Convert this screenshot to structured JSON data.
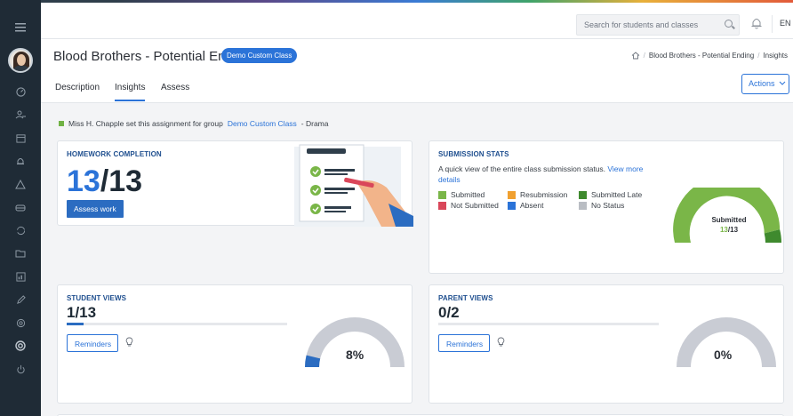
{
  "topbar": {
    "search_placeholder": "Search for students and classes",
    "language": "EN"
  },
  "header": {
    "title": "Blood Brothers - Potential Ending",
    "class_badge": "Demo Custom Class",
    "breadcrumb": [
      "Blood Brothers - Potential Ending",
      "Insights"
    ]
  },
  "tabs": [
    {
      "label": "Description"
    },
    {
      "label": "Insights",
      "active": true
    },
    {
      "label": "Assess"
    }
  ],
  "actions_label": "Actions",
  "note": {
    "prefix": "Miss H. Chapple set this assignment for group",
    "group": "Demo Custom Class",
    "suffix": "- Drama"
  },
  "homework": {
    "title": "HOMEWORK COMPLETION",
    "done": "13",
    "total": "/13",
    "button": "Assess work"
  },
  "submission": {
    "title": "SUBMISSION STATS",
    "desc": "A quick view of the entire class submission status.",
    "link": "View more details",
    "legend": [
      {
        "label": "Submitted",
        "color": "#7ab648"
      },
      {
        "label": "Resubmission",
        "color": "#f0a030"
      },
      {
        "label": "Submitted Late",
        "color": "#3f8a2e"
      },
      {
        "label": "Not Submitted",
        "color": "#d9475a"
      },
      {
        "label": "Absent",
        "color": "#2b73d8"
      },
      {
        "label": "No Status",
        "color": "#b9bdc3"
      }
    ],
    "gauge_label": "Submitted",
    "gauge_done": "13",
    "gauge_total": "/13",
    "submitted_fraction": 0.92,
    "late_fraction": 0.08
  },
  "student_views": {
    "title": "STUDENT VIEWS",
    "value": "1/13",
    "percent_label": "8%",
    "fraction": 0.077,
    "button": "Reminders"
  },
  "parent_views": {
    "title": "PARENT VIEWS",
    "value": "0/2",
    "percent_label": "0%",
    "fraction": 0,
    "button": "Reminders"
  },
  "colors": {
    "accent": "#2b73d8",
    "sidebar": "#1f2b36",
    "gauge_track": "#c9ccd4"
  }
}
